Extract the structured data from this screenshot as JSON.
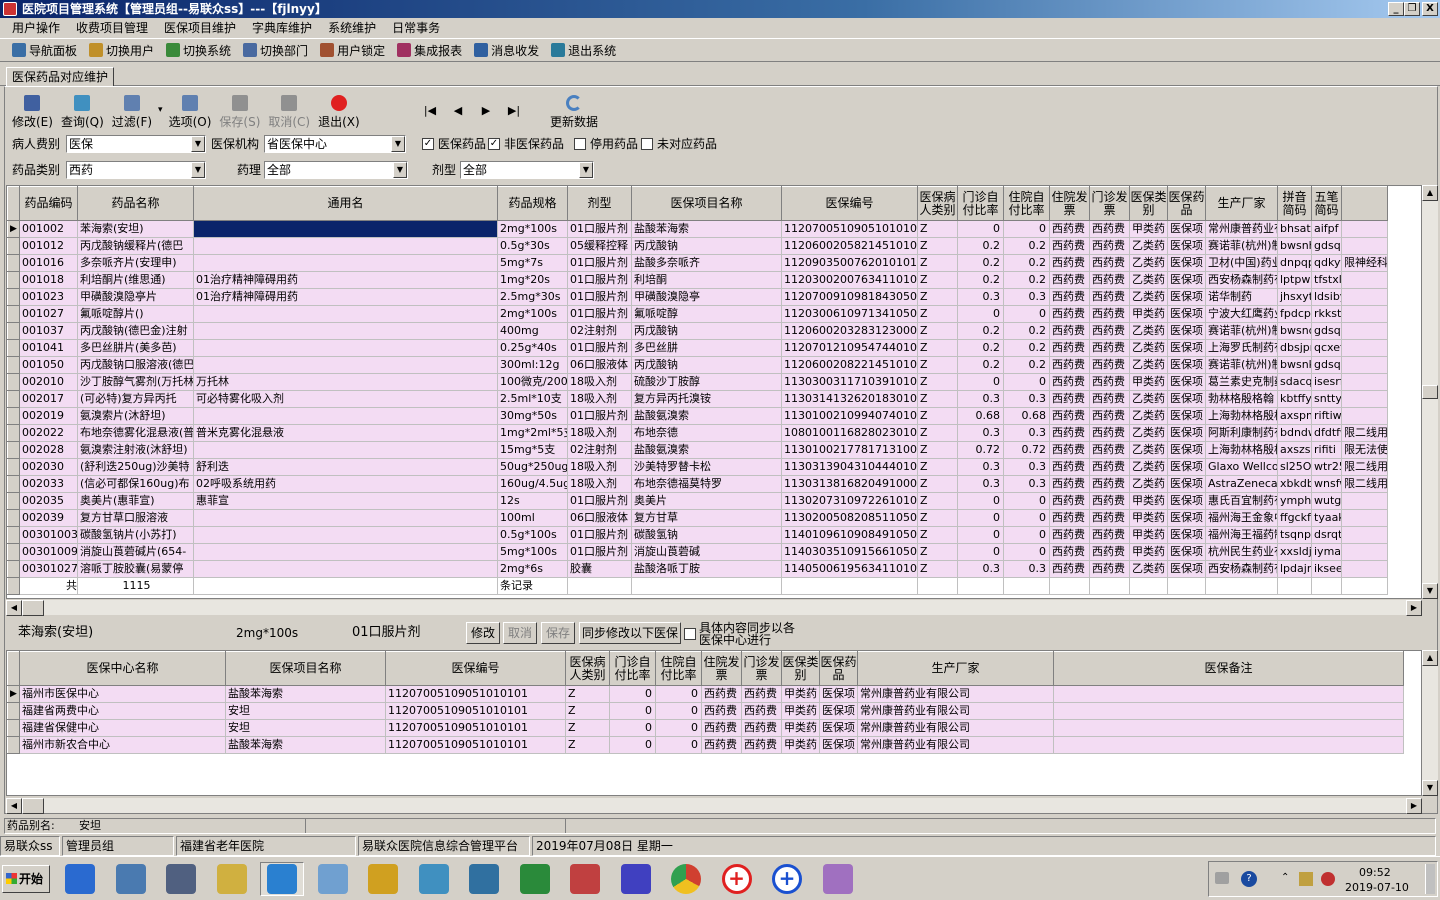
{
  "window": {
    "title": "医院项目管理系统【管理员组--易联众ss】---【fjlnyy】",
    "min": "_",
    "max": "❐",
    "close": "X"
  },
  "menu": [
    "用户操作",
    "收费项目管理",
    "医保项目维护",
    "字典库维护",
    "系统维护",
    "日常事务"
  ],
  "toolbar": [
    {
      "label": "导航面板",
      "icon": "navigation-panel-icon",
      "color": "#3a6ea5"
    },
    {
      "label": "切换用户",
      "icon": "switch-user-icon",
      "color": "#c0902a"
    },
    {
      "label": "切换系统",
      "icon": "switch-system-icon",
      "color": "#3a8a3a"
    },
    {
      "label": "切换部门",
      "icon": "switch-department-icon",
      "color": "#4a6aa0"
    },
    {
      "label": "用户锁定",
      "icon": "user-lock-icon",
      "color": "#a05030"
    },
    {
      "label": "集成报表",
      "icon": "report-icon",
      "color": "#a03060"
    },
    {
      "label": "消息收发",
      "icon": "message-icon",
      "color": "#3060a0"
    },
    {
      "label": "退出系统",
      "icon": "exit-system-icon",
      "color": "#2a7a9a"
    }
  ],
  "tab": "医保药品对应维护",
  "actions": [
    {
      "label": "修改(E)",
      "icon": "edit-icon",
      "disabled": false,
      "color": "#4060a0"
    },
    {
      "label": "查询(Q)",
      "icon": "search-icon",
      "disabled": false,
      "color": "#4090c0"
    },
    {
      "label": "过滤(F)",
      "icon": "filter-icon",
      "disabled": false,
      "color": "#6080b0"
    },
    {
      "label": "选项(O)",
      "icon": "options-icon",
      "disabled": false,
      "color": "#6080b0"
    },
    {
      "label": "保存(S)",
      "icon": "save-icon",
      "disabled": true,
      "color": "#909090"
    },
    {
      "label": "取消(C)",
      "icon": "cancel-icon",
      "disabled": true,
      "color": "#909090"
    },
    {
      "label": "退出(X)",
      "icon": "exit-icon",
      "disabled": false,
      "color": "#e02020"
    }
  ],
  "nav": {
    "first": "|◀",
    "prev": "◀",
    "next": "▶",
    "last": "▶|",
    "refresh": "更新数据"
  },
  "filters": {
    "patient_type_label": "病人费别",
    "patient_type": "医保",
    "insurer_label": "医保机构",
    "insurer": "省医保中心",
    "chk_insured": "医保药品",
    "chk_uninsured": "非医保药品",
    "chk_disabled": "停用药品",
    "chk_unmatched": "未对应药品",
    "drug_class_label": "药品类别",
    "drug_class": "西药",
    "pharmacology_label": "药理",
    "pharmacology": "全部",
    "dosage_label": "剂型",
    "dosage": "全部"
  },
  "main_table": {
    "headers": [
      "药品编码",
      "药品名称",
      "通用名",
      "药品规格",
      "剂型",
      "医保项目名称",
      "医保编号",
      "医保病人类别",
      "门诊自付比率",
      "住院自付比率",
      "住院发票",
      "门诊发票",
      "医保类别",
      "医保药品",
      "生产厂家",
      "拼音简码",
      "五笔简码",
      ""
    ],
    "rows": [
      [
        "001002",
        "苯海索(安坦)",
        "",
        "2mg*100s",
        "01口服片剂",
        "盐酸苯海索",
        "1120700510905101010​1",
        "Z",
        "0",
        "0",
        "西药费",
        "西药费",
        "甲类药",
        "医保项",
        "常州康普药业有限",
        "bhsat",
        "aifpf",
        ""
      ],
      [
        "001012",
        "丙戊酸钠缓释片(德巴",
        "",
        "0.5g*30s",
        "05缓释控释",
        "丙戊酸钠",
        "112060020582145101​01",
        "Z",
        "0.2",
        "0.2",
        "西药费",
        "西药费",
        "乙类药",
        "医保项",
        "赛诺菲(杭州)制药",
        "bwsnhs",
        "gdsqxt",
        ""
      ],
      [
        "001016",
        "多奈哌齐片(安理申)",
        "",
        "5mg*7s",
        "01口服片剂",
        "盐酸多奈哌齐",
        "112090350076201010​1",
        "Z",
        "0.2",
        "0.2",
        "西药费",
        "西药费",
        "乙类药",
        "医保项",
        "卫材(中国)药业",
        "dnpqps",
        "qdkytp",
        "限神经科"
      ],
      [
        "001018",
        "利培酮片(维思通)",
        "01治疗精神障碍用药",
        "1mg*20s",
        "01口服片剂",
        "利培酮",
        "112030020076341101​01",
        "Z",
        "0.2",
        "0.2",
        "西药费",
        "西药费",
        "乙类药",
        "医保项",
        "西安杨森制药有限",
        "lptpws",
        "tfstxl",
        ""
      ],
      [
        "001023",
        "甲磺酸溴隐亭片",
        "01治疗精神障碍用药",
        "2.5mg*30s",
        "01口服片剂",
        "甲磺酸溴隐亭",
        "112070091098184305​01",
        "Z",
        "0.3",
        "0.3",
        "西药费",
        "西药费",
        "乙类药",
        "医保项",
        "诺华制药",
        "jhsxyt",
        "ldsiby",
        ""
      ],
      [
        "001027",
        "氟哌啶醇片()",
        "",
        "2mg*100s",
        "01口服片剂",
        "氟哌啶醇",
        "1120300610971341050​1",
        "Z",
        "0",
        "0",
        "西药费",
        "西药费",
        "甲类药",
        "医保项",
        "宁波大红鹰药业股",
        "fpdcp",
        "rkkst",
        ""
      ],
      [
        "001037",
        "丙戊酸钠(德巴金)注射",
        "",
        "400mg",
        "02注射剂",
        "丙戊酸钠",
        "112060020328312300​01",
        "Z",
        "0.2",
        "0.2",
        "西药费",
        "西药费",
        "乙类药",
        "医保项",
        "赛诺菲(杭州)制药",
        "bwsndb",
        "gdsqtc",
        ""
      ],
      [
        "001041",
        "多巴丝肼片(美多芭)",
        "",
        "0.25g*40s",
        "01口服片剂",
        "多巴丝肼",
        "112070121095474401​02",
        "Z",
        "0.2",
        "0.2",
        "西药费",
        "西药费",
        "乙类药",
        "医保项",
        "上海罗氏制药有限",
        "dbsjpm",
        "qcxetu",
        ""
      ],
      [
        "001050",
        "丙戊酸钠口服溶液(德巴金",
        "",
        "300ml:12g",
        "06口服液体",
        "丙戊酸钠",
        "112060020822145101​01",
        "Z",
        "0.2",
        "0.2",
        "西药费",
        "西药费",
        "乙类药",
        "医保项",
        "赛诺菲(杭州)制药",
        "bwsnkf",
        "gdsqke",
        ""
      ],
      [
        "002010",
        "沙丁胺醇气雾剂(万托林)",
        "万托林",
        "100微克/200",
        "18吸入剂",
        "硫酸沙丁胺醇",
        "1130300311710391010​1",
        "Z",
        "0",
        "0",
        "西药费",
        "西药费",
        "甲类药",
        "医保项",
        "葛兰素史克制药",
        "sdacqw",
        "isesrf",
        ""
      ],
      [
        "002017",
        "(可必特)复方异丙托",
        "可必特雾化吸入剂",
        "2.5ml*10支",
        "18吸入剂",
        "复方异丙托溴铵",
        "113031413262018301​01",
        "Z",
        "0.3",
        "0.3",
        "西药费",
        "西药费",
        "乙类药",
        "医保项",
        "勃林格殷格翰",
        "kbtffy",
        "snttyn",
        ""
      ],
      [
        "002019",
        "氨溴索片(沐舒坦)",
        "",
        "30mg*50s",
        "01口服片剂",
        "盐酸氨溴索",
        "113010021099407401​02",
        "Z",
        "0.68",
        "0.68",
        "西药费",
        "西药费",
        "乙类药",
        "医保项",
        "上海勃林格殷格翰",
        "axspms",
        "riftiw",
        ""
      ],
      [
        "002022",
        "布地奈德雾化混悬液(普米克",
        "普米克雾化混悬液",
        "1mg*2ml*5支",
        "18吸入剂",
        "布地奈德",
        "1080100116828023010​1",
        "Z",
        "0.3",
        "0.3",
        "西药费",
        "西药费",
        "乙类药",
        "医保项",
        "阿斯利康制药有限",
        "bdndwh",
        "dfdtfw",
        "限二线用"
      ],
      [
        "002028",
        "氨溴索注射液(沐舒坦)",
        "",
        "15mg*5支",
        "02注射剂",
        "盐酸氨溴索",
        "113010021778171310​01",
        "Z",
        "0.72",
        "0.72",
        "西药费",
        "西药费",
        "乙类药",
        "医保项",
        "上海勃林格殷格翰",
        "axszsy",
        "rifiti",
        "限无法使"
      ],
      [
        "002030",
        "(舒利迭250ug)沙美特",
        "舒利迭",
        "50ug*250ug*1",
        "18吸入剂",
        "沙美特罗替卡松",
        "113031390431044401​02",
        "Z",
        "0.3",
        "0.3",
        "西药费",
        "西药费",
        "乙类药",
        "医保项",
        "Glaxo Wellcome",
        "sl25Ot",
        "wtr250",
        "限二线用"
      ],
      [
        "002033",
        "(信必可都保160ug)布",
        "02呼吸系统用药",
        "160ug/4.5ug",
        "18吸入剂",
        "布地奈德福莫特罗",
        "113031381682049100​01",
        "Z",
        "0.3",
        "0.3",
        "西药费",
        "西药费",
        "乙类药",
        "医保项",
        "AstraZeneca(瑞典",
        "xbkdbl",
        "wnsfwl",
        "限二线用"
      ],
      [
        "002035",
        "奥美片(惠菲宣)",
        "惠菲宣",
        "12s",
        "01口服片剂",
        "奥美片",
        "113020731097226101​01",
        "Z",
        "0",
        "0",
        "西药费",
        "西药费",
        "甲类药",
        "医保项",
        "惠氏百宜制药有限",
        "ymphfx",
        "wutgap",
        ""
      ],
      [
        "002039",
        "复方甘草口服溶液",
        "",
        "100ml",
        "06口服液体",
        "复方甘草",
        "113020050820851105​02",
        "Z",
        "0",
        "0",
        "西药费",
        "西药费",
        "甲类药",
        "医保项",
        "福州海王金象中药",
        "ffgckf",
        "tyaake",
        ""
      ],
      [
        "00301003",
        "碳酸氢钠片(小苏打)",
        "",
        "0.5g*100s",
        "01口服片剂",
        "碳酸氢钠",
        "1140109610908491050​1",
        "Z",
        "0",
        "0",
        "西药费",
        "西药费",
        "甲类药",
        "医保项",
        "福州海王福药制药",
        "tsqnpx",
        "dsrqti",
        ""
      ],
      [
        "00301009",
        "消旋山莨菪碱片(654-",
        "",
        "5mg*100s",
        "01口服片剂",
        "消旋山莨菪碱",
        "114030351091566105​01",
        "Z",
        "0",
        "0",
        "西药费",
        "西药费",
        "甲类药",
        "医保项",
        "杭州民生药业有限",
        "xxsldj",
        "iymaad",
        ""
      ],
      [
        "00301027",
        "溶哌丁胺胶囊(易蒙停",
        "",
        "2mg*6s",
        "胶囊",
        "盐酸洛哌丁胺",
        "114050061956341101​01",
        "Z",
        "0.3",
        "0.3",
        "西药费",
        "西药费",
        "乙类药",
        "医保项",
        "西安杨森制药有限",
        "lpdajr",
        "ikseeg",
        ""
      ]
    ],
    "footer": {
      "total_label": "共",
      "total": "1115",
      "records_label": "条记录"
    }
  },
  "detail": {
    "name": "苯海索(安坦)",
    "spec": "2mg*100s",
    "form": "01口服片剂",
    "btn_edit": "修改",
    "btn_cancel": "取消",
    "btn_save": "保存",
    "btn_sync": "同步修改以下医保",
    "sync_note": "具体内容同步以各医保中心进行"
  },
  "sub_table": {
    "headers": [
      "医保中心名称",
      "医保项目名称",
      "医保编号",
      "医保病人类别",
      "门诊自付比率",
      "住院自付比率",
      "住院发票",
      "门诊发票",
      "医保类别",
      "医保药品",
      "生产厂家",
      "医保备注"
    ],
    "rows": [
      [
        "福州市医保中心",
        "盐酸苯海索",
        "1120700510905101010​1",
        "Z",
        "0",
        "0",
        "西药费",
        "西药费",
        "甲类药",
        "医保项",
        "常州康普药业有限公司",
        ""
      ],
      [
        "福建省两费中心",
        "安坦",
        "1120700510905101010​1",
        "Z",
        "0",
        "0",
        "西药费",
        "西药费",
        "甲类药",
        "医保项",
        "常州康普药业有限公司",
        ""
      ],
      [
        "福建省保健中心",
        "安坦",
        "1120700510905101010​1",
        "Z",
        "0",
        "0",
        "西药费",
        "西药费",
        "甲类药",
        "医保项",
        "常州康普药业有限公司",
        ""
      ],
      [
        "福州市新农合中心",
        "盐酸苯海索",
        "1120700510905101010​1",
        "Z",
        "0",
        "0",
        "西药费",
        "西药费",
        "甲类药",
        "医保项",
        "常州康普药业有限公司",
        ""
      ]
    ]
  },
  "alias": {
    "label": "药品别名:",
    "value": "安坦"
  },
  "status": [
    "易联众ss",
    "管理员组",
    "福建省老年医院",
    "易联众医院信息综合管理平台",
    "2019年07月08日 星期一"
  ],
  "taskbar": {
    "start": "开始",
    "time": "09:52",
    "date": "2019-07-10",
    "apps": [
      {
        "icon": "ie-icon",
        "color": "#2a6ad0"
      },
      {
        "icon": "sql-query-icon",
        "color": "#4a7ab0"
      },
      {
        "icon": "network-icon",
        "color": "#506080"
      },
      {
        "icon": "folder-icon",
        "color": "#d0b040"
      },
      {
        "icon": "hospital-app-icon",
        "color": "#2a80d0"
      },
      {
        "icon": "notebook-icon",
        "color": "#70a0d0"
      },
      {
        "icon": "sql-server-icon",
        "color": "#d0a020"
      },
      {
        "icon": "meeting-icon",
        "color": "#4090c0"
      },
      {
        "icon": "doctor-icon",
        "color": "#3070a0"
      },
      {
        "icon": "excel-icon",
        "color": "#2a8a3a"
      },
      {
        "icon": "nurse-icon",
        "color": "#c04040"
      },
      {
        "icon": "diamond-app-icon",
        "color": "#4040c0"
      },
      {
        "icon": "chrome-icon",
        "color": "#d04030"
      },
      {
        "icon": "red-cross-icon",
        "color": "#e02020"
      },
      {
        "icon": "blue-cross-icon",
        "color": "#1a50d0"
      },
      {
        "icon": "paint-icon",
        "color": "#a070c0"
      }
    ]
  }
}
